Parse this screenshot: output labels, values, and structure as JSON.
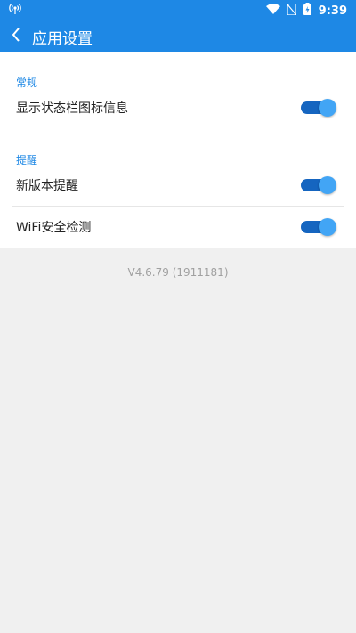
{
  "status_bar": {
    "time": "9:39",
    "icons": [
      "antenna-icon",
      "wifi-icon",
      "no-sim-icon",
      "battery-charging-icon"
    ]
  },
  "app_bar": {
    "title": "应用设置",
    "back_icon": "chevron-left-icon"
  },
  "sections": [
    {
      "header": "常规",
      "items": [
        {
          "label": "显示状态栏图标信息",
          "enabled": true
        }
      ]
    },
    {
      "header": "提醒",
      "items": [
        {
          "label": "新版本提醒",
          "enabled": true
        },
        {
          "label": "WiFi安全检测",
          "enabled": true
        }
      ]
    }
  ],
  "version": "V4.6.79 (1911181)",
  "colors": {
    "primary": "#1e88e5",
    "toggle_track": "#1565c0",
    "toggle_knob": "#42a5f5",
    "background": "#f0f0f0"
  }
}
